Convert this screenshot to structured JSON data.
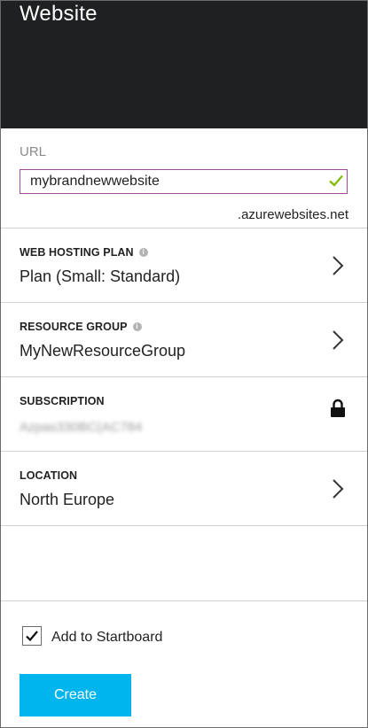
{
  "header": {
    "title": "Website"
  },
  "url": {
    "label": "URL",
    "value": "mybrandnewwebsite",
    "suffix": ".azurewebsites.net",
    "valid_icon": "checkmark-icon",
    "valid_color": "#7fba00",
    "focus_border_color": "#9b4c9a"
  },
  "web_hosting_plan": {
    "label": "WEB HOSTING PLAN",
    "value": "Plan (Small: Standard)",
    "icon": "chevron-right-icon"
  },
  "resource_group": {
    "label": "RESOURCE GROUP",
    "value": "MyNewResourceGroup",
    "icon": "chevron-right-icon"
  },
  "subscription": {
    "label": "SUBSCRIPTION",
    "value": "Azpas330BC(AC784",
    "icon": "lock-icon"
  },
  "location": {
    "label": "LOCATION",
    "value": "North Europe",
    "icon": "chevron-right-icon"
  },
  "startboard": {
    "label": "Add to Startboard",
    "checked": true
  },
  "create_button": {
    "label": "Create",
    "color": "#00b4ee"
  }
}
